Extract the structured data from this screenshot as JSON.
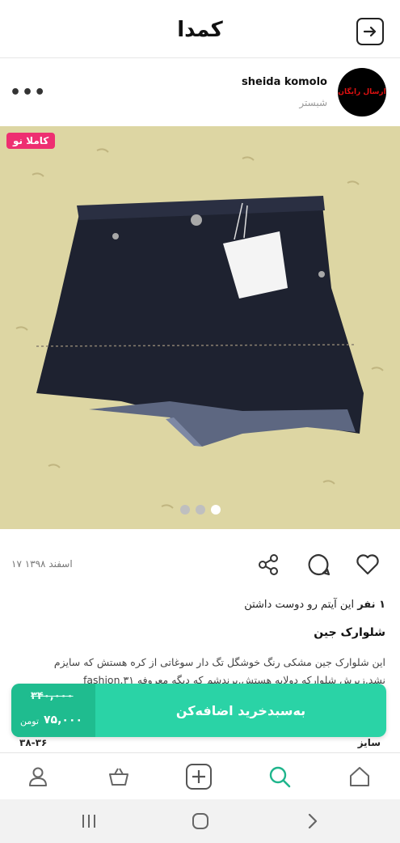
{
  "app": {
    "logo": "کمدا"
  },
  "seller": {
    "name": "sheida komolo",
    "city": "شبستر",
    "avatar_text": "ارسال رایگان"
  },
  "product": {
    "badge": "کاملا نو",
    "image_count": 3,
    "active_image_index": 0,
    "post_date": "۱۷ اسفند ۱۳۹۸",
    "likes_count": "۱ نفر",
    "likes_text": "این آیتم رو دوست داشتن",
    "title": "شلوارک جین",
    "description": "این شلوارک جین مشکی رنگ خوشگل تگ دار  سوغاتی از کره هستش که سایزم نشد.زیرش شلوارکه  دولایه هستش.برندشم که دیگه معروفه fashion.۳۱",
    "size_label": "سایز",
    "size_value": "۳۸-۳۶"
  },
  "cart": {
    "old_price": "۳۴۰,۰۰۰",
    "new_price": "۷۵,۰۰۰",
    "currency": "تومن",
    "button_label": "به‌سبد‌خرید اضافه‌کن"
  },
  "colors": {
    "accent": "#2ad3a6",
    "accent_dark": "#1fbc8f",
    "badge": "#ee2f71",
    "nav_active": "#1fb58c"
  },
  "icons": {
    "back": "arrow-right-in-box-icon",
    "more": "more-dots-icon",
    "share": "share-icon",
    "comment": "comment-icon",
    "like": "heart-icon",
    "nav": [
      "profile-icon",
      "basket-icon",
      "add-item-icon",
      "search-icon",
      "home-icon"
    ],
    "system": [
      "recent-apps-icon",
      "home-button-icon",
      "back-chevron-icon"
    ]
  }
}
